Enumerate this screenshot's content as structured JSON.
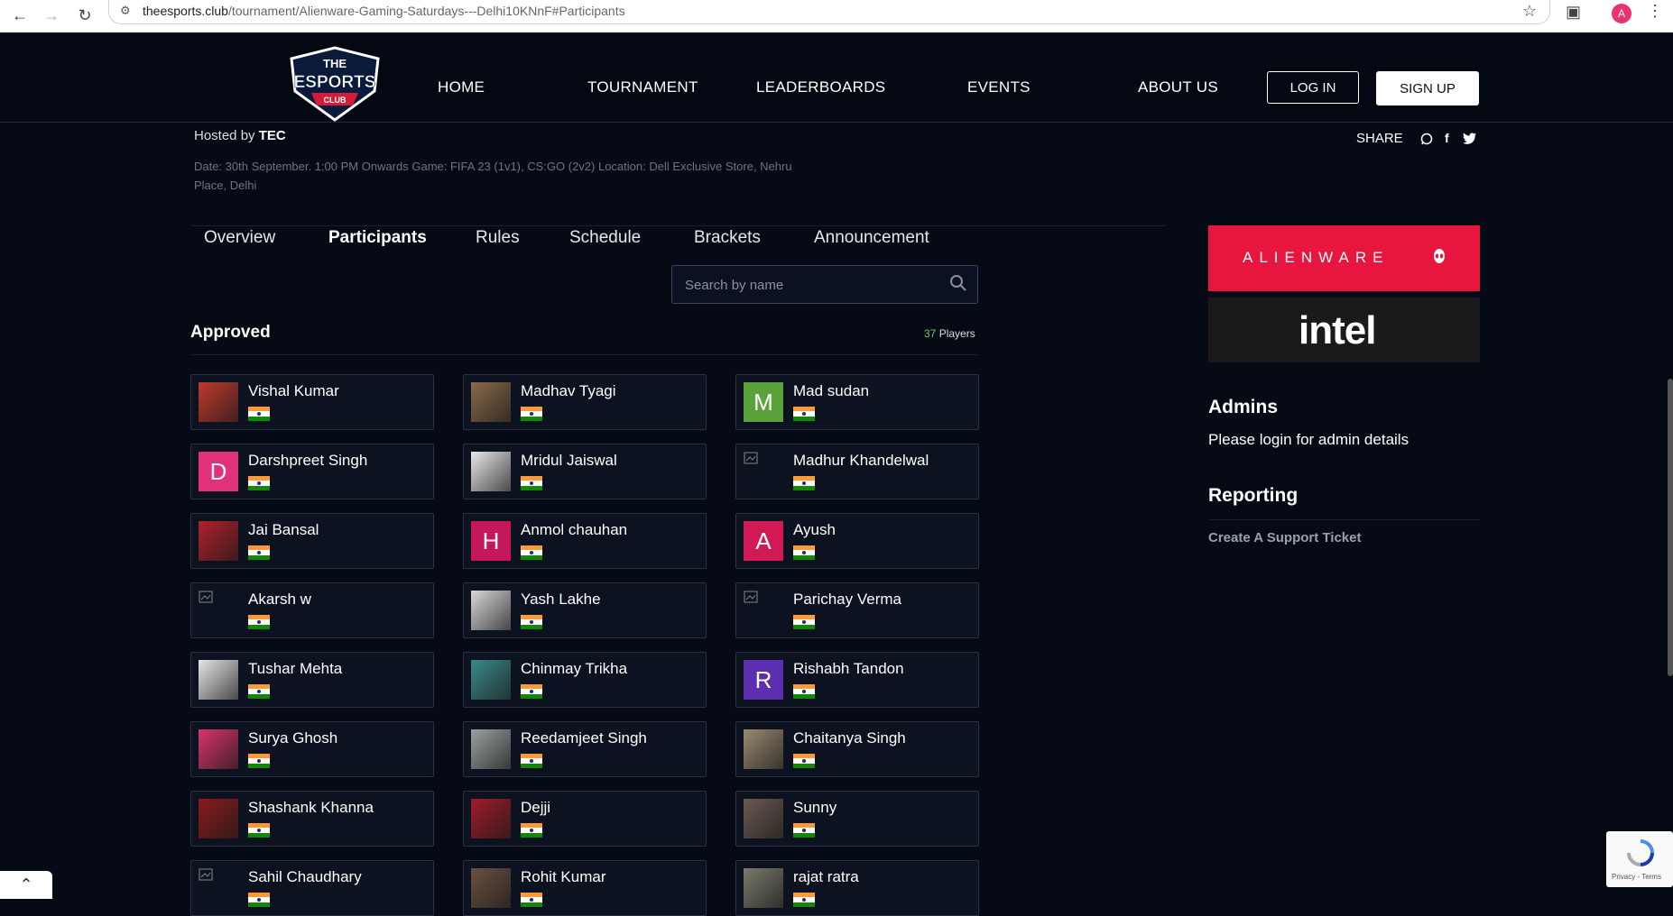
{
  "browser": {
    "url_host": "theesports.club",
    "url_path": "/tournament/Alienware-Gaming-Saturdays---Delhi10KNnF#Participants",
    "profile_initial": "A"
  },
  "header": {
    "logo_line1": "THE",
    "logo_line2": "ESPORTS",
    "logo_line3": "CLUB",
    "nav": [
      "HOME",
      "TOURNAMENT",
      "LEADERBOARDS",
      "EVENTS",
      "ABOUT US"
    ],
    "login_label": "LOG IN",
    "signup_label": "SIGN UP"
  },
  "tournament": {
    "hosted_prefix": "Hosted by",
    "host": "TEC",
    "description": "Date: 30th September. 1:00 PM Onwards Game: FIFA 23 (1v1), CS:GO (2v2) Location: Dell Exclusive Store, Nehru Place, Delhi",
    "share_label": "SHARE"
  },
  "tabs": [
    "Overview",
    "Participants",
    "Rules",
    "Schedule",
    "Brackets",
    "Announcement"
  ],
  "active_tab": "Participants",
  "search": {
    "placeholder": "Search by name"
  },
  "participants": {
    "heading": "Approved",
    "count": "37",
    "count_suffix": "Players",
    "list": [
      {
        "name": "Vishal Kumar",
        "avatar": "photo",
        "color": "#c0392b"
      },
      {
        "name": "Madhav Tyagi",
        "avatar": "photo",
        "color": "#8a6a4a"
      },
      {
        "name": "Mad sudan",
        "avatar": "letter",
        "letter": "M",
        "color": "#5aa33a"
      },
      {
        "name": "Darshpreet Singh",
        "avatar": "letter",
        "letter": "D",
        "color": "#e0317a"
      },
      {
        "name": "Mridul Jaiswal",
        "avatar": "photo",
        "color": "#e8e8e8"
      },
      {
        "name": "Madhur Khandelwal",
        "avatar": "broken",
        "color": "#0d1220"
      },
      {
        "name": "Jai Bansal",
        "avatar": "photo",
        "color": "#b0202a"
      },
      {
        "name": "Anmol chauhan",
        "avatar": "letter",
        "letter": "H",
        "color": "#c4185a"
      },
      {
        "name": "Ayush",
        "avatar": "letter",
        "letter": "A",
        "color": "#d11a55"
      },
      {
        "name": "Akarsh w",
        "avatar": "broken",
        "color": "#0d1220"
      },
      {
        "name": "Yash Lakhe",
        "avatar": "photo",
        "color": "#d8d8d8"
      },
      {
        "name": "Parichay Verma",
        "avatar": "broken",
        "color": "#0d1220"
      },
      {
        "name": "Tushar Mehta",
        "avatar": "photo",
        "color": "#e6e6e6"
      },
      {
        "name": "Chinmay Trikha",
        "avatar": "photo",
        "color": "#3a8a8a"
      },
      {
        "name": "Rishabh Tandon",
        "avatar": "letter",
        "letter": "R",
        "color": "#5b2fb0"
      },
      {
        "name": "Surya Ghosh",
        "avatar": "photo",
        "color": "#d8346a"
      },
      {
        "name": "Reedamjeet Singh",
        "avatar": "photo",
        "color": "#9aa0a0"
      },
      {
        "name": "Chaitanya Singh",
        "avatar": "photo",
        "color": "#9a8a70"
      },
      {
        "name": "Shashank Khanna",
        "avatar": "photo",
        "color": "#8a1a1a"
      },
      {
        "name": "Dejji",
        "avatar": "photo",
        "color": "#a01a2a"
      },
      {
        "name": "Sunny",
        "avatar": "photo",
        "color": "#6a5a50"
      },
      {
        "name": "Sahil Chaudhary",
        "avatar": "broken",
        "color": "#0d1220"
      },
      {
        "name": "Rohit Kumar",
        "avatar": "photo",
        "color": "#6a5040"
      },
      {
        "name": "rajat ratra",
        "avatar": "photo",
        "color": "#7a7a6a"
      }
    ]
  },
  "sidebar": {
    "sponsor1": "ALIENWARE",
    "sponsor2": "intel",
    "admins_heading": "Admins",
    "admins_text": "Please login for admin details",
    "reporting_heading": "Reporting",
    "ticket_link": "Create A Support Ticket"
  },
  "captcha": {
    "text": "Privacy - Terms"
  },
  "colors": {
    "accent_green": "#6fce5a",
    "alienware_red": "#e8163f",
    "background": "#060a14"
  }
}
